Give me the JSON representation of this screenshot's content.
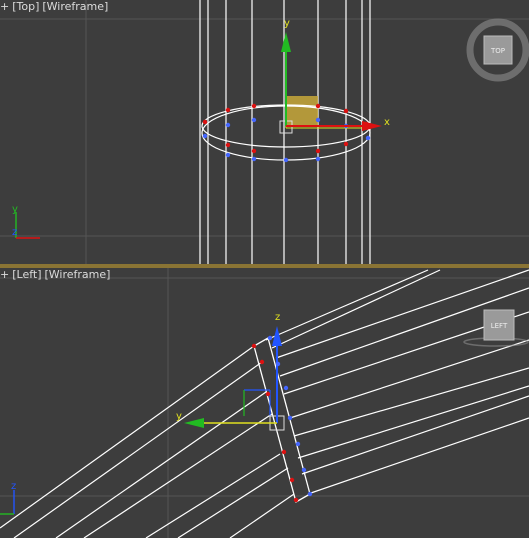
{
  "viewports": {
    "top": {
      "menu": "+",
      "view": "[Top]",
      "mode": "[Wireframe]",
      "viewcube_label": "TOP",
      "axis_labels": {
        "x": "x",
        "y": "y"
      },
      "corner_axes": {
        "y": "y",
        "z": "z"
      }
    },
    "left": {
      "menu": "+",
      "view": "[Left]",
      "mode": "[Wireframe]",
      "viewcube_label": "LEFT",
      "axis_labels": {
        "z": "z",
        "y": "y"
      },
      "corner_axes": {
        "z": "z"
      }
    }
  },
  "colors": {
    "background": "#3d3d3d",
    "grid": "#555555",
    "wire": "#ffffff",
    "active_border": "#8a7434",
    "vertex_red": "#dd1111",
    "vertex_blue": "#4466ff",
    "axis_x": "#dd1111",
    "axis_y": "#22bb22",
    "axis_z": "#2255ff",
    "gizmo_yellow": "#e0e020"
  }
}
